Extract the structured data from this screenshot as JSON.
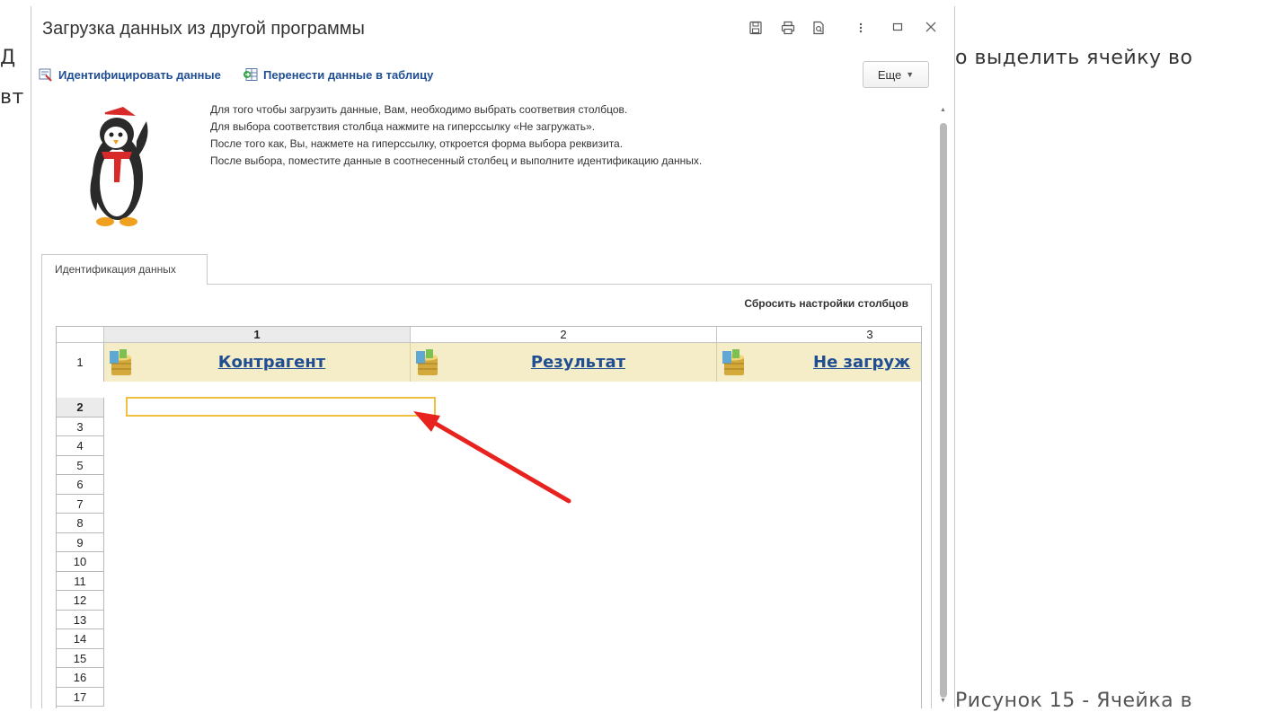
{
  "background": {
    "left_line1": "Д",
    "left_line2": "вт",
    "right_line1": "о выделить ячейку во",
    "caption": "Рисунок 15 - Ячейка в"
  },
  "window": {
    "title": "Загрузка данных из другой программы",
    "titlebar_icons": [
      "save-icon",
      "print-icon",
      "preview-icon",
      "more-vertical-icon",
      "maximize-icon",
      "close-icon"
    ]
  },
  "commands": {
    "identify": "Идентифицировать данные",
    "transfer": "Перенести данные в таблицу",
    "more": "Еще"
  },
  "info_lines": [
    "Для того чтобы загрузить данные, Вам, необходимо выбрать соответвия столбцов.",
    "Для выбора соответствия столбца нажмите на гиперссылку «Не загружать».",
    "После того как, Вы, нажмете на гиперссылку, откроется форма выбора реквизита.",
    "После выбора, поместите данные в соотнесенный столбец и выполните идентификацию данных."
  ],
  "tab": {
    "label": "Идентификация данных"
  },
  "reset_link": "Сбросить настройки столбцов",
  "grid": {
    "columns": [
      "1",
      "2",
      "3"
    ],
    "header_row_number": "1",
    "header_cells": [
      "Контрагент",
      "Результат",
      "Не загруж"
    ],
    "rows": [
      "2",
      "3",
      "4",
      "5",
      "6",
      "7",
      "8",
      "9",
      "10",
      "11",
      "12",
      "13",
      "14",
      "15",
      "16",
      "17"
    ],
    "selected_cell": "2:1"
  },
  "colors": {
    "link": "#1f4e93",
    "header_fill": "#f5ecc8",
    "selection": "#f0c040",
    "annotation_arrow": "#e8231f"
  }
}
